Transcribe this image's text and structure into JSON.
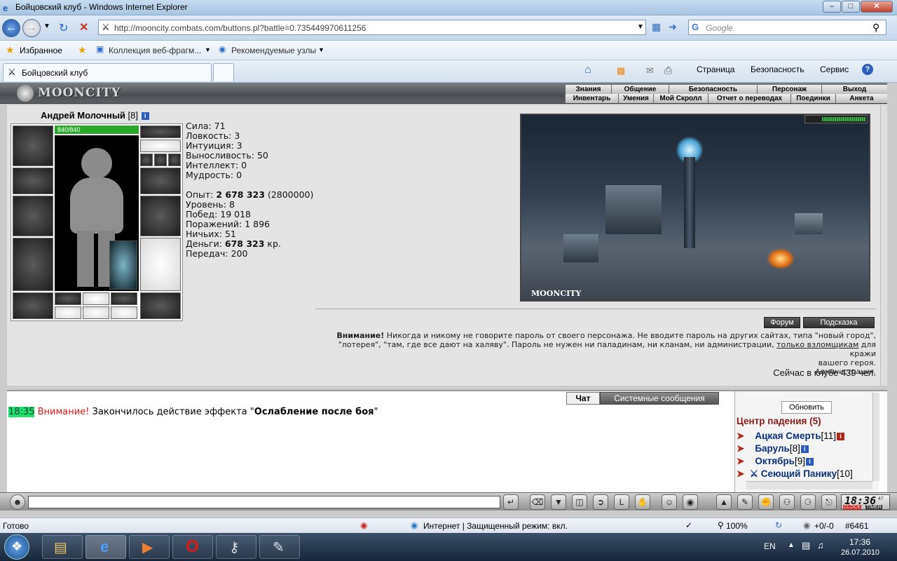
{
  "window": {
    "title": "Бойцовский клуб - Windows Internet Explorer",
    "min": "–",
    "max": "□",
    "close": "✕"
  },
  "nav": {
    "url": "http://mooncity.combats.com/buttons.pl?battle=0.735449970611256",
    "search_placeholder": "Google"
  },
  "favorites": {
    "label": "Избранное",
    "items": [
      "Коллекция веб-фрагм...",
      "Рекомендуемые узлы"
    ]
  },
  "tab": {
    "title": "Бойцовский клуб"
  },
  "commands": {
    "page": "Страница",
    "safety": "Безопасность",
    "service": "Сервис"
  },
  "game": {
    "logo": "MOONCITY",
    "menu_top": [
      "Знания",
      "Общение",
      "Безопасность",
      "Персонаж",
      "Выход"
    ],
    "menu_bottom": [
      "Инвентарь",
      "Умения",
      "Мой Скролл",
      "Отчет о переводах",
      "Поединки",
      "Анкета"
    ],
    "character": {
      "name": "Андрей Молочный",
      "level": "[8]",
      "hp": "840/840",
      "hp_fraction": 1.0
    },
    "stats": {
      "strength": "Сила: 71",
      "agility": "Ловкость: 3",
      "intuition": "Интуиция: 3",
      "endurance": "Выносливость: 50",
      "intellect": "Интеллект: 0",
      "wisdom": "Мудрость: 0",
      "exp_label": "Опыт:",
      "exp_value": "2 678 323",
      "exp_next": "(2800000)",
      "level": "Уровень: 8",
      "wins": "Побед: 19 018",
      "losses": "Поражений: 1 896",
      "draws": "Ничьих: 51",
      "money_label": "Деньги:",
      "money_value": "678 323",
      "money_unit": "кр.",
      "transfers": "Передач: 200"
    },
    "scene_caption": "MOONCITY",
    "buttons": {
      "forum": "Форум",
      "hint": "Подсказка"
    },
    "warning": {
      "bold": "Внимание!",
      "text1": " Никогда и никому не говорите пароль от своего персонажа. Не вводите пароль на других сайтах, типа \"новый город\",",
      "text2": "\"лотерея\", \"там, где все дают на халяву\". Пароль не нужен ни паладинам, ни кланам, ни администрации, ",
      "link": "только взломщикам",
      "text3": " для кражи",
      "text4": "вашего героя.",
      "admin": "Администрация."
    },
    "online": "Сейчас в клубе 439 чел.",
    "chat_tabs": [
      "Чат",
      "Системные сообщения"
    ],
    "chat": {
      "time": "18:35",
      "alert": "Внимание!",
      "text": " Закончилось действие эффекта \"",
      "effect": "Ослабление после боя",
      "end": "\""
    },
    "side": {
      "refresh": "Обновить",
      "location": "Центр падения (5)",
      "players": [
        {
          "name": "Ацкая Смерть",
          "level": "[11]"
        },
        {
          "name": "Баруль",
          "level": "[8]"
        },
        {
          "name": "Октябрь",
          "level": "[9]"
        },
        {
          "name": "Сеющий Панику",
          "level": "[10]"
        }
      ]
    },
    "clock": "18:36",
    "clock_sec": "47",
    "clock_label1": "CLOCK",
    "clock_label2": "TIMER"
  },
  "status": {
    "ready": "Готово",
    "zone": "Интернет | Защищенный режим: вкл.",
    "zoom": "100%",
    "counter": "+0/-0",
    "num": "#6461"
  },
  "taskbar": {
    "lang": "EN",
    "time": "17:36",
    "date": "26.07.2010"
  }
}
